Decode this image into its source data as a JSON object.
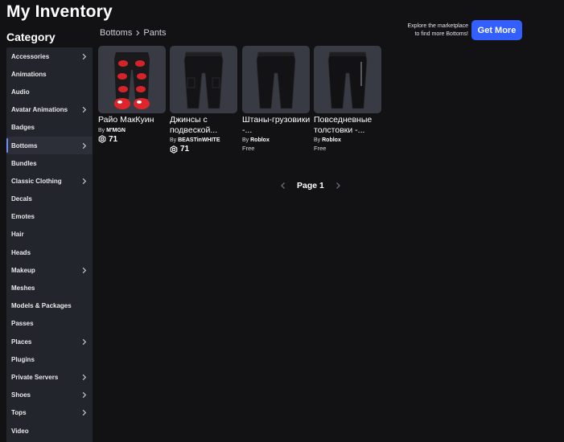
{
  "page": {
    "title": "My Inventory"
  },
  "sidebar": {
    "heading": "Category",
    "items": [
      {
        "label": "Accessories",
        "chevron": true
      },
      {
        "label": "Animations",
        "chevron": false
      },
      {
        "label": "Audio",
        "chevron": false
      },
      {
        "label": "Avatar Animations",
        "chevron": true
      },
      {
        "label": "Badges",
        "chevron": false
      },
      {
        "label": "Bottoms",
        "chevron": true,
        "active": true
      },
      {
        "label": "Bundles",
        "chevron": false
      },
      {
        "label": "Classic Clothing",
        "chevron": true
      },
      {
        "label": "Decals",
        "chevron": false
      },
      {
        "label": "Emotes",
        "chevron": false
      },
      {
        "label": "Hair",
        "chevron": false
      },
      {
        "label": "Heads",
        "chevron": false
      },
      {
        "label": "Makeup",
        "chevron": true
      },
      {
        "label": "Meshes",
        "chevron": false
      },
      {
        "label": "Models & Packages",
        "chevron": false
      },
      {
        "label": "Passes",
        "chevron": false
      },
      {
        "label": "Places",
        "chevron": true
      },
      {
        "label": "Plugins",
        "chevron": false
      },
      {
        "label": "Private Servers",
        "chevron": true
      },
      {
        "label": "Shoes",
        "chevron": true
      },
      {
        "label": "Tops",
        "chevron": true
      },
      {
        "label": "Video",
        "chevron": false
      }
    ]
  },
  "breadcrumb": {
    "parent": "Bottoms",
    "current": "Pants"
  },
  "promo": {
    "line1": "Explore the marketplace",
    "line2": "to find more Bottoms!",
    "button_label": "Get More"
  },
  "items": [
    {
      "name": "Райо МакКуин",
      "by": "By",
      "creator": "M'MGN",
      "price": "71",
      "currency": "robux",
      "thumb": "red-car-pants"
    },
    {
      "name": "Джинсы с подвеской...",
      "by": "By",
      "creator": "BEASTinWHITE",
      "price": "71",
      "currency": "robux",
      "thumb": "black-cargo-pants"
    },
    {
      "name": "Штаны-грузовики -...",
      "by": "By",
      "creator": "Roblox",
      "price": "Free",
      "currency": "free",
      "thumb": "black-pants"
    },
    {
      "name": "Повседневные толстовки -...",
      "by": "By",
      "creator": "Roblox",
      "price": "Free",
      "currency": "free",
      "thumb": "black-joggers"
    }
  ],
  "pagination": {
    "label": "Page 1"
  },
  "colors": {
    "accent": "#335fff",
    "background": "#121215",
    "sidebar": "#23252c",
    "thumb_bg": "#393b44"
  }
}
